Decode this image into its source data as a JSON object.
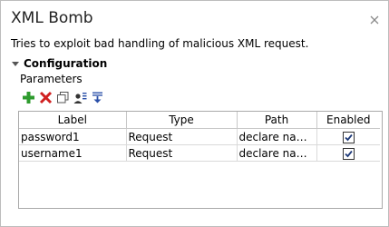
{
  "window": {
    "title": "XML Bomb",
    "description": "Tries to exploit bad handling of malicious XML request."
  },
  "configuration": {
    "section_label": "Configuration",
    "parameters_label": "Parameters",
    "toolbar": [
      {
        "name": "add-icon",
        "color": "#2e9b2e"
      },
      {
        "name": "delete-icon",
        "color": "#d02020"
      },
      {
        "name": "copy-icon",
        "color": "#555555"
      },
      {
        "name": "user-list-icon",
        "color": "#333333"
      },
      {
        "name": "sort-down-icon",
        "color": "#2a4fa8"
      }
    ],
    "table": {
      "columns": [
        "Label",
        "Type",
        "Path",
        "Enabled"
      ],
      "rows": [
        {
          "label": "password1",
          "type": "Request",
          "path": "declare names...",
          "enabled": true
        },
        {
          "label": "username1",
          "type": "Request",
          "path": "declare names...",
          "enabled": true
        }
      ]
    }
  }
}
